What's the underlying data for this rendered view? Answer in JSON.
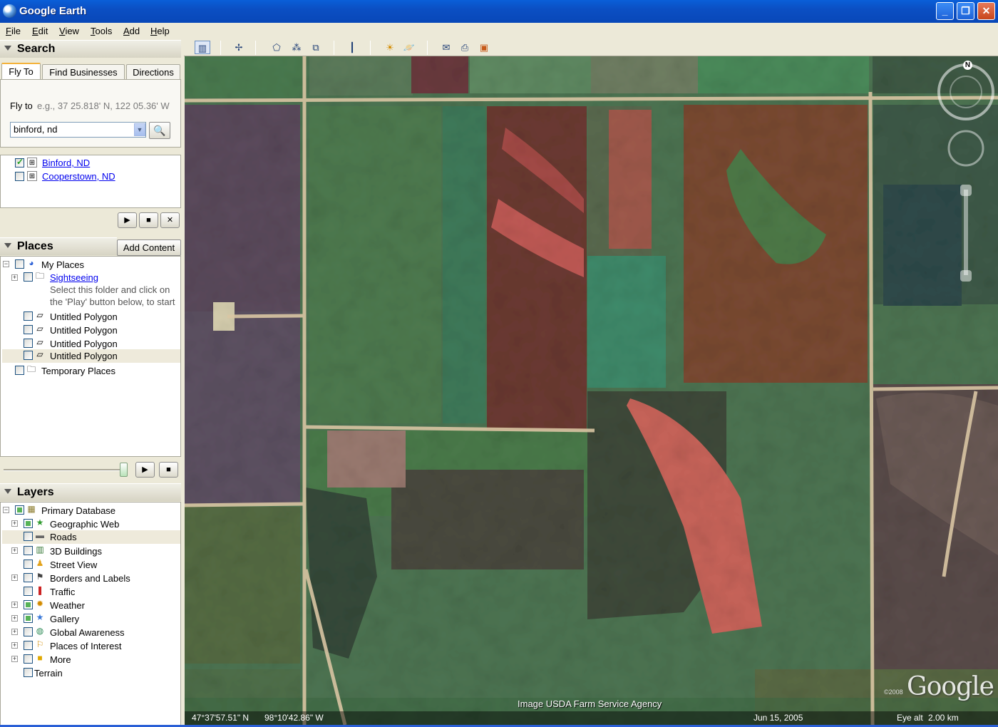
{
  "window": {
    "title": "Google Earth"
  },
  "menu": [
    "File",
    "Edit",
    "View",
    "Tools",
    "Add",
    "Help"
  ],
  "search": {
    "header": "Search",
    "tabs": [
      "Fly To",
      "Find Businesses",
      "Directions"
    ],
    "fly_to_label": "Fly to",
    "fly_to_hint": "e.g., 37 25.818' N, 122 05.36' W",
    "input_value": "binford, nd",
    "results": [
      "Binford, ND",
      "Cooperstown, ND"
    ]
  },
  "places": {
    "header": "Places",
    "add_content": "Add Content",
    "my_places": "My Places",
    "sightseeing": "Sightseeing",
    "sightseeing_note_1": "Select this folder and click on",
    "sightseeing_note_2": "the 'Play' button below, to start",
    "polygons": [
      "Untitled Polygon",
      "Untitled Polygon",
      "Untitled Polygon",
      "Untitled Polygon"
    ],
    "temporary": "Temporary Places"
  },
  "layers": {
    "header": "Layers",
    "primary": "Primary Database",
    "items": [
      "Geographic Web",
      "Roads",
      "3D Buildings",
      "Street View",
      "Borders and Labels",
      "Traffic",
      "Weather",
      "Gallery",
      "Global Awareness",
      "Places of Interest",
      "More"
    ],
    "terrain": "Terrain"
  },
  "status": {
    "lat": "47°37'57.51\" N",
    "lon": "98°10'42.86\" W",
    "date": "Jun 15, 2005",
    "eye_label": "Eye alt",
    "eye_value": "2.00 km"
  },
  "map": {
    "attribution": "Image USDA Farm Service Agency",
    "logo": "Google",
    "copyright": "©2008",
    "compass_north": "N"
  }
}
